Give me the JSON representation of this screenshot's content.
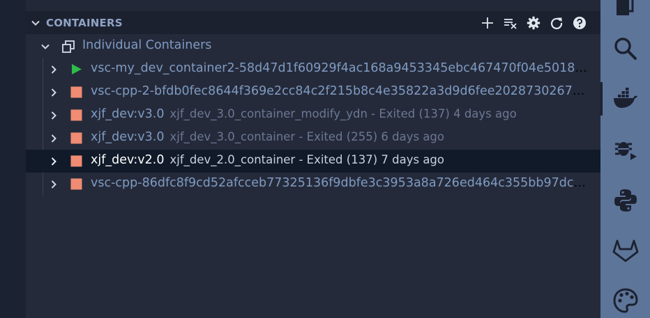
{
  "section": {
    "title": "CONTAINERS",
    "actions": [
      {
        "name": "add-icon"
      },
      {
        "name": "clear-list-icon"
      },
      {
        "name": "gear-icon"
      },
      {
        "name": "refresh-icon"
      },
      {
        "name": "help-icon"
      }
    ]
  },
  "group": {
    "label": "Individual Containers",
    "icon": "containers-group-icon"
  },
  "containers": [
    {
      "name": "vsc-my_dev_container2-58d47d1f60929f4ac168a9453345ebc467470f04e501806a...",
      "desc": "",
      "status": "running",
      "selected": false
    },
    {
      "name": "vsc-cpp-2-bfdb0fec8644f369e2cc84c2f215b8c4e35822a3d9d6fee202873026706c...",
      "desc": "",
      "status": "stopped",
      "selected": false
    },
    {
      "name": "xjf_dev:v3.0",
      "desc": "xjf_dev_3.0_container_modify_ydn - Exited (137) 4 days ago",
      "status": "stopped",
      "selected": false
    },
    {
      "name": "xjf_dev:v3.0",
      "desc": "xjf_dev_3.0_container - Exited (255) 6 days ago",
      "status": "stopped",
      "selected": false
    },
    {
      "name": "xjf_dev:v2.0",
      "desc": "xjf_dev_2.0_container - Exited (137) 7 days ago",
      "status": "stopped",
      "selected": true
    },
    {
      "name": "vsc-cpp-86dfc8f9cd52afcceb77325136f9dbfe3c3953a8a726ed464c355bb97dcec...",
      "desc": "",
      "status": "stopped",
      "selected": false
    }
  ],
  "colors": {
    "running": "#2dbb4a",
    "stopped": "#f08c73",
    "activity_bar": "#5d7599",
    "panel": "#252a3a"
  },
  "activity_bar": [
    {
      "name": "explorer-icon",
      "active": false
    },
    {
      "name": "search-icon",
      "active": false
    },
    {
      "name": "docker-icon",
      "active": true
    },
    {
      "name": "run-debug-icon",
      "active": false
    },
    {
      "name": "python-icon",
      "active": false
    },
    {
      "name": "gitlab-icon",
      "active": false
    },
    {
      "name": "palette-icon",
      "active": false
    }
  ]
}
